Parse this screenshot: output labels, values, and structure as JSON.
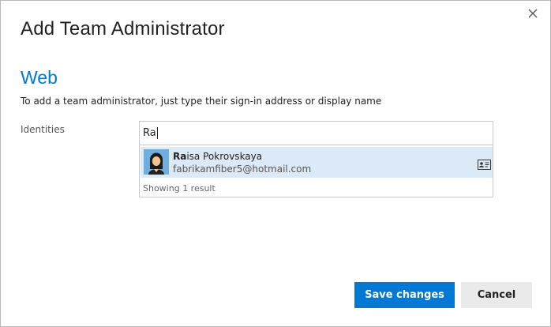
{
  "dialog": {
    "title": "Add Team Administrator",
    "close_icon": "close-icon"
  },
  "section": {
    "heading": "Web",
    "instructions": "To add a team administrator, just type their sign-in address or display name"
  },
  "identities": {
    "label": "Identities",
    "input_value": "Ra",
    "suggestions": [
      {
        "name_match": "Ra",
        "name_rest": "isa Pokrovskaya",
        "email": "fabrikamfiber5@hotmail.com",
        "avatar_icon": "user-avatar-icon",
        "card_icon": "contact-card-icon"
      }
    ],
    "result_count": "Showing 1 result"
  },
  "footer": {
    "save_label": "Save changes",
    "cancel_label": "Cancel"
  },
  "colors": {
    "accent": "#0078d4",
    "selected_row": "#dce9f7",
    "cancel_bg": "#eaeaea"
  }
}
